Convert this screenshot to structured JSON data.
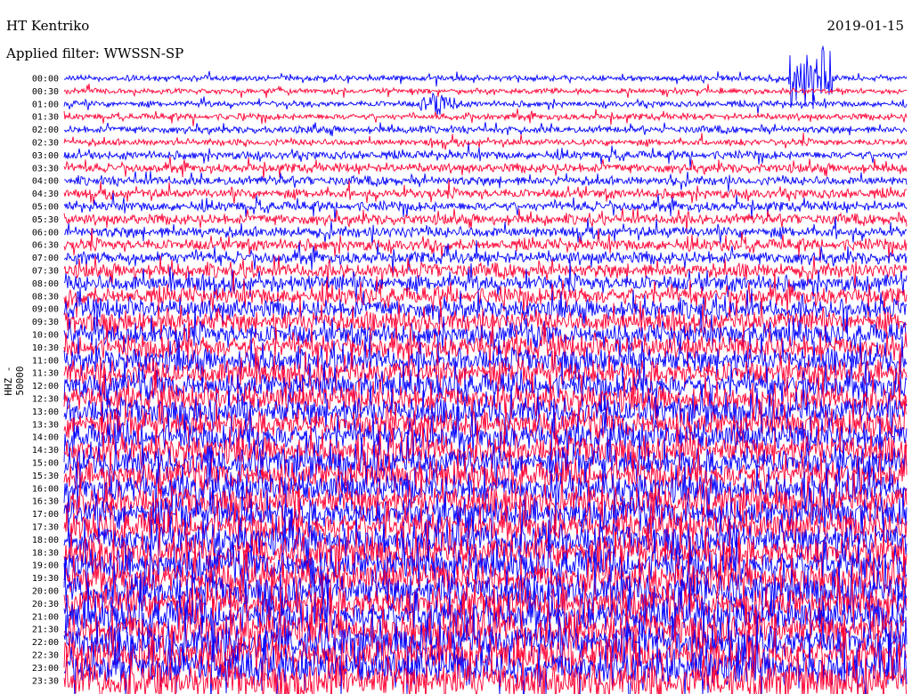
{
  "header": {
    "station": "HT Kentriko",
    "filter": "Applied filter: WWSSN-SP",
    "date": "2019-01-15"
  },
  "chart_data": {
    "type": "line",
    "title": "HT Kentriko",
    "subtitle": "Applied filter: WWSSN-SP",
    "ylabel": "HHZ - 50000",
    "date": "2019-01-15",
    "row_labels": [
      "00:00",
      "00:30",
      "01:00",
      "01:30",
      "02:00",
      "02:30",
      "03:00",
      "03:30",
      "04:00",
      "04:30",
      "05:00",
      "05:30",
      "06:00",
      "06:30",
      "07:00",
      "07:30",
      "08:00",
      "08:30",
      "09:00",
      "09:30",
      "10:00",
      "10:30",
      "11:00",
      "11:30",
      "12:00",
      "12:30",
      "13:00",
      "13:30",
      "14:00",
      "14:30",
      "15:00",
      "15:30",
      "16:00",
      "16:30",
      "17:00",
      "17:30",
      "18:00",
      "18:30",
      "19:00",
      "19:30",
      "20:00",
      "20:30",
      "21:00",
      "21:30",
      "22:00",
      "22:30",
      "23:00",
      "23:30"
    ],
    "trace_colors": [
      "#0000ff",
      "#ff0033"
    ],
    "relative_activity": [
      0.08,
      0.07,
      0.09,
      0.1,
      0.12,
      0.11,
      0.16,
      0.18,
      0.18,
      0.2,
      0.2,
      0.22,
      0.24,
      0.26,
      0.28,
      0.34,
      0.4,
      0.44,
      0.48,
      0.52,
      0.56,
      0.6,
      0.62,
      0.64,
      0.66,
      0.68,
      0.7,
      0.7,
      0.72,
      0.72,
      0.74,
      0.74,
      0.76,
      0.76,
      0.78,
      0.78,
      0.8,
      0.8,
      0.82,
      0.82,
      0.84,
      0.84,
      0.86,
      0.86,
      0.88,
      0.88,
      0.9,
      0.9
    ],
    "events": [
      {
        "row": "01:00",
        "position": "left-center",
        "note": "burst"
      },
      {
        "row": "00:00",
        "position": "right",
        "note": "large spike"
      }
    ],
    "grid": false
  }
}
